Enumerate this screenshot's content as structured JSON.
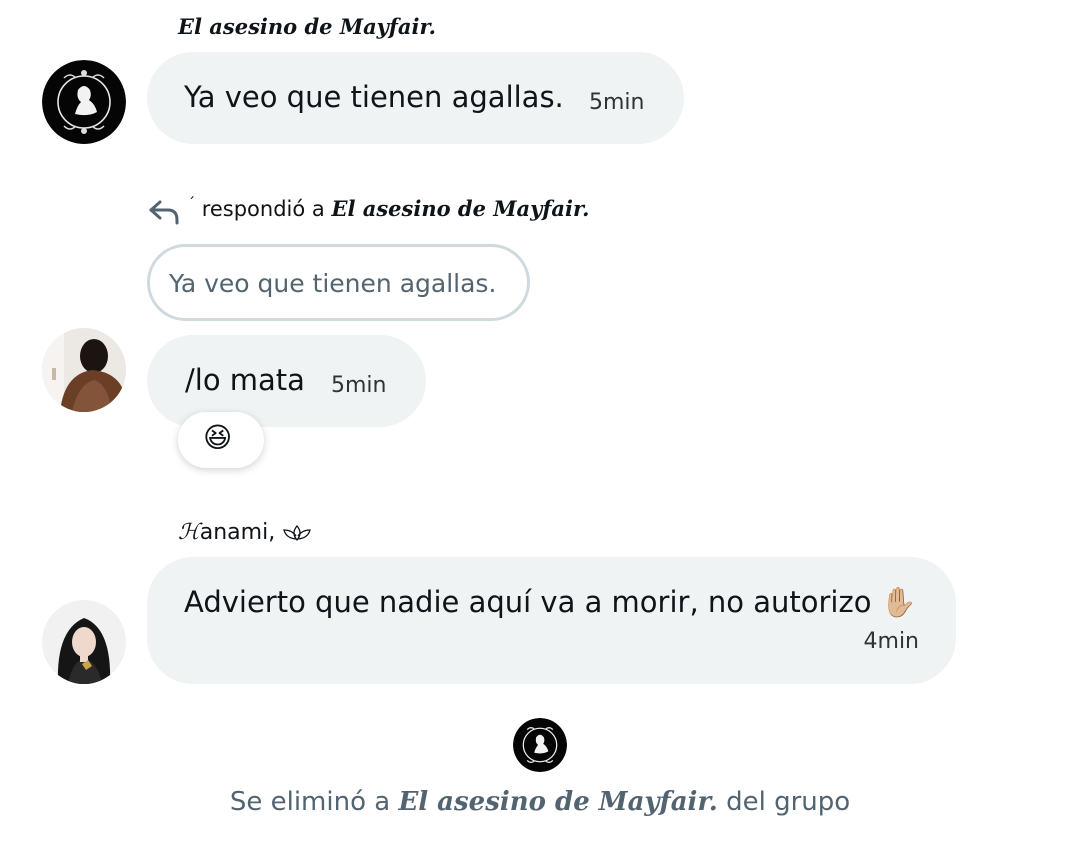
{
  "colors": {
    "bubble_bg": "#eff3f4",
    "quote_border": "#cfd9de",
    "secondary_text": "#536471",
    "primary_text": "#0f1419"
  },
  "messages": [
    {
      "sender": "El asesino de Mayfair.",
      "avatar_icon": "silhouette-cameo-icon",
      "text": "Ya veo que tienen agallas.",
      "time": "5min"
    },
    {
      "reply_prefix": "respondió a",
      "reply_target": "El asesino de Mayfair.",
      "quoted_text": "Ya veo que tienen agallas.",
      "avatar_icon": "person-back-photo",
      "text": "/lo mata",
      "time": "5min",
      "reaction": "😆"
    },
    {
      "sender_initial": "ℋ",
      "sender_rest": "anami,",
      "sender_icon": "lotus-icon",
      "avatar_icon": "girl-portrait-photo",
      "text": "Advierto que nadie aquí va a morir, no autorizo",
      "emoji": "✋🏼",
      "time": "4min"
    }
  ],
  "system": {
    "avatar_icon": "silhouette-cameo-icon",
    "prefix": "Se eliminó a",
    "name": "El asesino de Mayfair.",
    "suffix": "del grupo"
  }
}
